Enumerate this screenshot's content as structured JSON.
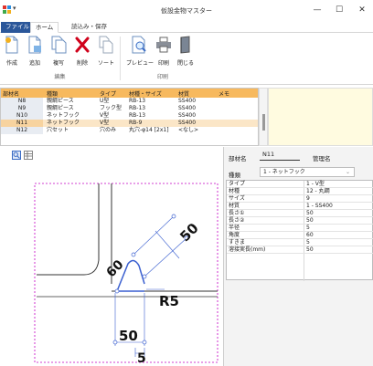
{
  "window": {
    "title": "仮設金物マスター",
    "qat_glyph": "▾",
    "minimize_glyph": "—",
    "maximize_glyph": "☐",
    "close_glyph": "✕"
  },
  "ribbon_tabs": [
    {
      "label": "ファイル"
    },
    {
      "label": "ホーム"
    },
    {
      "label": "読込み・保存"
    }
  ],
  "ribbon": {
    "buttons": [
      {
        "label": "作成",
        "icon": "new-doc-icon"
      },
      {
        "label": "追加",
        "icon": "add-doc-icon"
      },
      {
        "label": "複写",
        "icon": "copy-icon"
      },
      {
        "label": "削除",
        "icon": "delete-x-icon"
      },
      {
        "label": "ソート",
        "icon": "sort-icon"
      },
      {
        "label": "プレビュー",
        "icon": "preview-icon"
      },
      {
        "label": "印刷",
        "icon": "printer-icon"
      },
      {
        "label": "閉じる",
        "icon": "close-book-icon"
      }
    ],
    "groups": [
      {
        "label": "編集"
      },
      {
        "label": "印刷"
      }
    ]
  },
  "list": {
    "headers": [
      "部材名",
      "種類",
      "タイプ",
      "材種・サイズ",
      "材質",
      "メモ"
    ],
    "rows": [
      {
        "name": "N8",
        "kind": "親綱ピース",
        "type": "U型",
        "spec": "RB-13",
        "material": "SS400",
        "memo": ""
      },
      {
        "name": "N9",
        "kind": "親綱ピース",
        "type": "フック型",
        "spec": "RB-13",
        "material": "SS400",
        "memo": ""
      },
      {
        "name": "N10",
        "kind": "ネットフック",
        "type": "V型",
        "spec": "RB-13",
        "material": "SS400",
        "memo": ""
      },
      {
        "name": "N11",
        "kind": "ネットフック",
        "type": "V型",
        "spec": "RB-9",
        "material": "SS400",
        "memo": ""
      },
      {
        "name": "N12",
        "kind": "穴セット",
        "type": "穴のみ",
        "spec": "丸穴-φ14 [2x1]",
        "material": "<なし>",
        "memo": ""
      }
    ],
    "selected_index": 3
  },
  "form": {
    "part_name_label": "部材名",
    "part_name_value": "N11",
    "admin_name_label": "管理名",
    "kind_label": "種類",
    "kind_value": "1 - ネットフック"
  },
  "properties": [
    {
      "key": "タイプ",
      "value": "1 - V型"
    },
    {
      "key": "材種",
      "value": "12 - 丸鋼"
    },
    {
      "key": "サイズ",
      "value": "9"
    },
    {
      "key": "材質",
      "value": "1 - SS400"
    },
    {
      "key": "長さ①",
      "value": "50"
    },
    {
      "key": "長さ②",
      "value": "50"
    },
    {
      "key": "半径",
      "value": "5"
    },
    {
      "key": "角度",
      "value": "60"
    },
    {
      "key": "すきま",
      "value": "5"
    },
    {
      "key": "溶接実長(mm)",
      "value": "50"
    }
  ],
  "drawing": {
    "dim_length_1": "50",
    "dim_angle": "60",
    "dim_radius": "R5",
    "dim_length_2": "50",
    "dim_gap": "5"
  },
  "colors": {
    "header": "#f7b95e",
    "selected_row": "#fbe6c7",
    "memo_bg": "#fffbe0",
    "file_tab": "#2b579a",
    "draw_line": "#3a5fd0",
    "frame_dash": "#c400c4",
    "delete_red": "#d0021b"
  }
}
